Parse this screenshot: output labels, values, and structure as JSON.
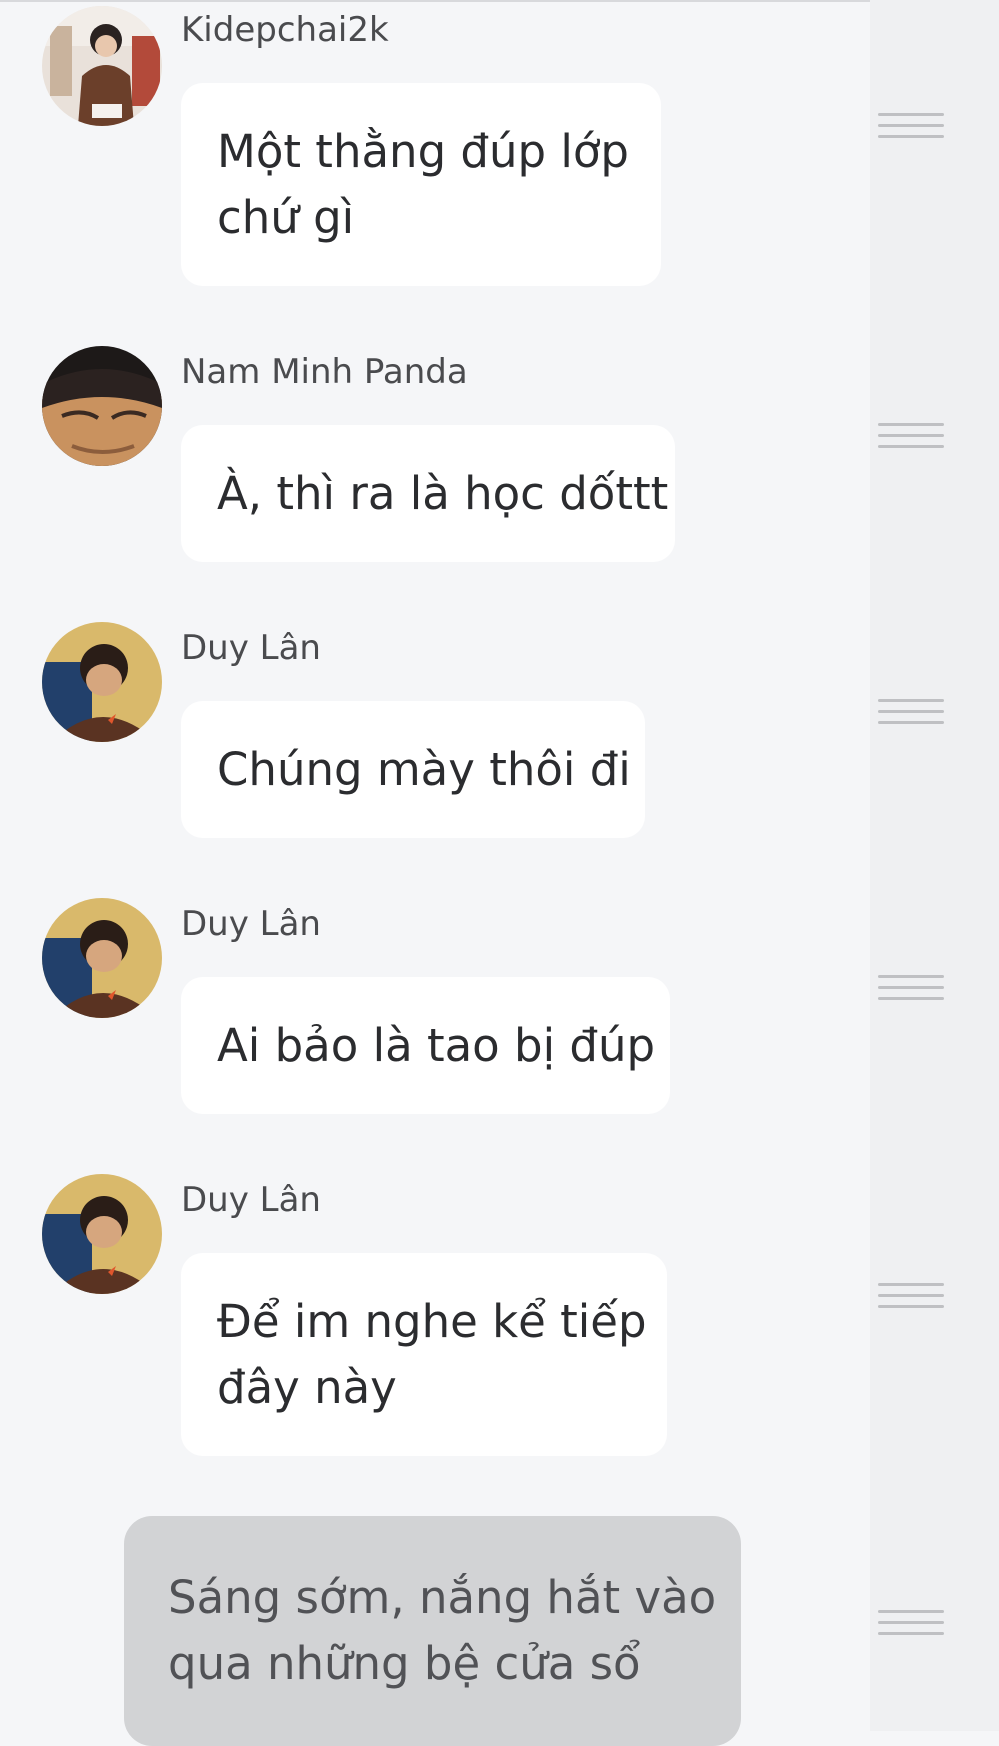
{
  "messages": [
    {
      "sender": "Kidepchai2k",
      "lines": [
        "Một thằng đúp lớp",
        "chứ gì"
      ]
    },
    {
      "sender": "Nam Minh Panda",
      "lines": [
        "À, thì ra là học dốttt"
      ]
    },
    {
      "sender": "Duy Lân",
      "lines": [
        "Chúng mày thôi đi"
      ]
    },
    {
      "sender": "Duy Lân",
      "lines": [
        "Ai bảo là tao bị đúp"
      ]
    },
    {
      "sender": "Duy Lân",
      "lines": [
        "Để im nghe kể tiếp",
        "đây này"
      ]
    }
  ],
  "narration": {
    "lines": [
      "Sáng sớm, nắng hắt vào",
      "qua những bệ cửa sổ"
    ]
  },
  "icons": {
    "avatar_1": "avatar-photo-icon",
    "avatar_2": "avatar-anime-icon",
    "avatar_3": "avatar-photo-icon",
    "drag_handle": "drag-handle-icon"
  },
  "colors": {
    "background": "#f5f6f8",
    "rail": "#eff0f2",
    "bubble": "#ffffff",
    "narration_bubble": "#d2d3d5",
    "text": "#2b2c2f",
    "sender_text": "#4a4b4e"
  }
}
